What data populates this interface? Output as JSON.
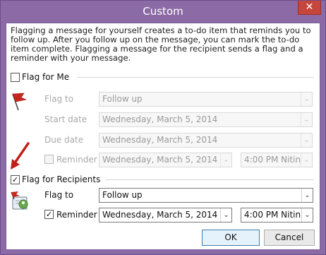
{
  "window": {
    "title": "Custom",
    "close_glyph": "✕"
  },
  "intro_text": "Flagging a message for yourself creates a to-do item that reminds you to follow up. After you follow up on the message, you can mark the to-do item complete. Flagging a message for the recipient sends a flag and a reminder with your message.",
  "flag_for_me": {
    "label": "Flag for Me",
    "checked": false,
    "flag_to_label": "Flag to",
    "flag_to_value": "Follow up",
    "start_date_label": "Start date",
    "start_date_value": "Wednesday, March 5, 2014",
    "due_date_label": "Due date",
    "due_date_value": "Wednesday, March 5, 2014",
    "reminder_label": "Reminder",
    "reminder_date": "Wednesday, March 5, 2014",
    "reminder_time": "4:00 PM Nitin"
  },
  "flag_for_recipients": {
    "label": "Flag for Recipients",
    "checked": true,
    "flag_to_label": "Flag to",
    "flag_to_value": "Follow up",
    "reminder_label": "Reminder",
    "reminder_checked": true,
    "reminder_date": "Wednesday, March 5, 2014",
    "reminder_time": "4:00 PM Nitin"
  },
  "buttons": {
    "ok": "OK",
    "cancel": "Cancel"
  },
  "glyphs": {
    "check": "✓",
    "dropdown": "⌄"
  },
  "colors": {
    "titlebar": "#8b6aa6",
    "close": "#c7463c",
    "flag_red": "#c8261c",
    "arrow_red": "#c0201a"
  },
  "icons": {
    "me_flag": "red-flag-icon",
    "recipient_flag": "contact-card-flag-icon",
    "annotation": "red-arrow-icon"
  }
}
